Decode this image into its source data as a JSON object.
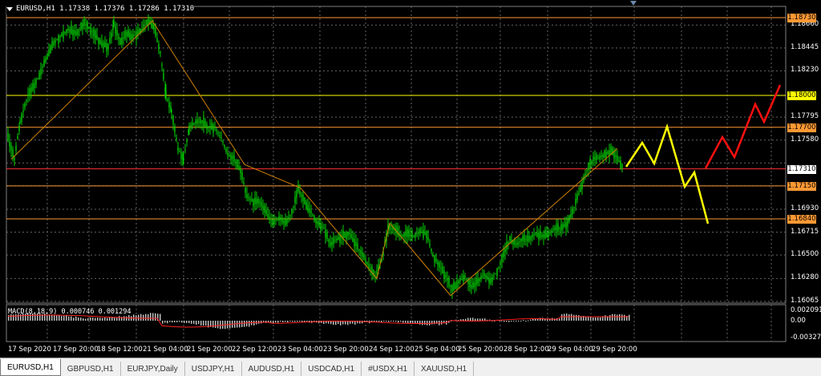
{
  "window": {
    "symbol_info": "EURUSD,H1  1.17338 1.17376 1.17286 1.17310"
  },
  "colors": {
    "background": "#000000",
    "grid": "#646464",
    "candle": "#00d000",
    "zigzag": "#d08000",
    "macd_hist": "#c0c0c0",
    "macd_signal": "#ff2020",
    "level_orange": "#ff9933",
    "level_yellow": "#ffff00",
    "level_red": "#ff3030",
    "projection_yellow": "#ffff00",
    "projection_red": "#ff1010"
  },
  "price_axis": {
    "labels": [
      "1.18660",
      "1.18445",
      "1.18230",
      "1.17795",
      "1.17580",
      "1.16930",
      "1.16715",
      "1.16500",
      "1.16280",
      "1.16065"
    ]
  },
  "price_tags": [
    {
      "value": "1.18730",
      "color": "#ff9933",
      "kind": "level"
    },
    {
      "value": "1.18000",
      "color": "#ffff00",
      "kind": "level"
    },
    {
      "value": "1.17700",
      "color": "#ff9933",
      "kind": "level"
    },
    {
      "value": "1.17310",
      "color": "#ffffff",
      "kind": "current"
    },
    {
      "value": "1.17150",
      "color": "#ff9933",
      "kind": "level"
    },
    {
      "value": "1.16840",
      "color": "#ff9933",
      "kind": "level"
    }
  ],
  "macd": {
    "label": "MACD(8,18,9) 0.000746 0.001294",
    "axis_labels": [
      "0.002091",
      "0.00",
      "-0.003272"
    ]
  },
  "time_axis": {
    "labels": [
      "17 Sep 2020",
      "17 Sep 20:00",
      "18 Sep 12:00",
      "21 Sep 04:00",
      "21 Sep 20:00",
      "22 Sep 12:00",
      "23 Sep 04:00",
      "23 Sep 20:00",
      "24 Sep 12:00",
      "25 Sep 04:00",
      "25 Sep 20:00",
      "28 Sep 12:00",
      "29 Sep 04:00",
      "29 Sep 20:00"
    ]
  },
  "tabs": [
    {
      "label": "EURUSD,H1",
      "active": true
    },
    {
      "label": "GBPUSD,H1",
      "active": false
    },
    {
      "label": "EURJPY,Daily",
      "active": false
    },
    {
      "label": "USDJPY,H1",
      "active": false
    },
    {
      "label": "AUDUSD,H1",
      "active": false
    },
    {
      "label": "USDCAD,H1",
      "active": false
    },
    {
      "label": "#USDX,H1",
      "active": false
    },
    {
      "label": "XAUUSD,H1",
      "active": false
    }
  ]
}
